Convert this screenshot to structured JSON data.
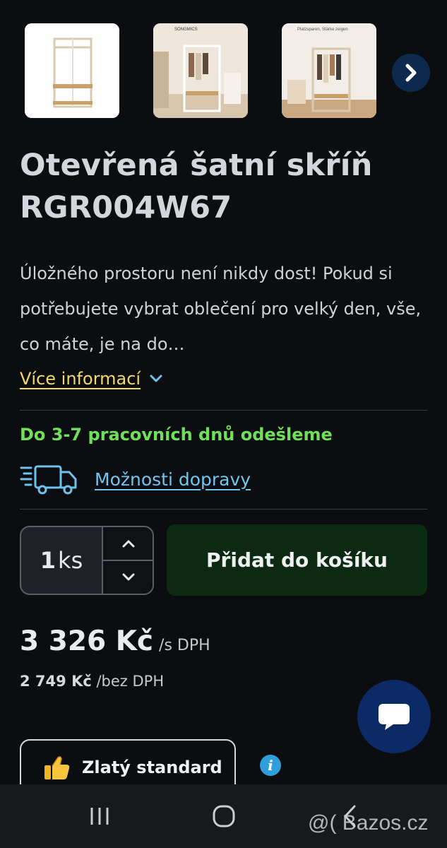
{
  "gallery": {
    "thumbnails": [
      {
        "name": "product-photo-1",
        "overlay_text": ""
      },
      {
        "name": "product-photo-2",
        "overlay_text": "SONGMICS"
      },
      {
        "name": "product-photo-3",
        "overlay_text": "Platzsparen, Stärke zeigen"
      }
    ],
    "next_icon": "chevron-right-icon"
  },
  "product": {
    "title": "Otevřená šatní skříň RGR004W67",
    "description": "Úložného prostoru není nikdy dost! Pokud si potřebujete vybrat oblečení pro velký den, vše, co máte, je na do…",
    "more_info_label": "Více informací"
  },
  "shipping": {
    "dispatch_text": "Do 3-7 pracovních dnů odešleme",
    "delivery_options_label": "Možnosti dopravy"
  },
  "quantity": {
    "value": "1",
    "unit": "ks"
  },
  "cart": {
    "add_label": "Přidat do košíku"
  },
  "price": {
    "with_vat": "3 326 Kč",
    "with_vat_suffix": "/s DPH",
    "without_vat": "2 749 Kč",
    "without_vat_suffix": "/bez DPH"
  },
  "badge": {
    "label": "Zlatý standard"
  },
  "info_icon_text": "i",
  "watermark": "@( Bazos.cz",
  "colors": {
    "background": "#0b0d10",
    "accent_yellow": "#f1d96b",
    "accent_green": "#6fe05a",
    "link_blue": "#71c6ef",
    "cart_button": "#0c2a12",
    "chat_button": "#0c2a66"
  }
}
